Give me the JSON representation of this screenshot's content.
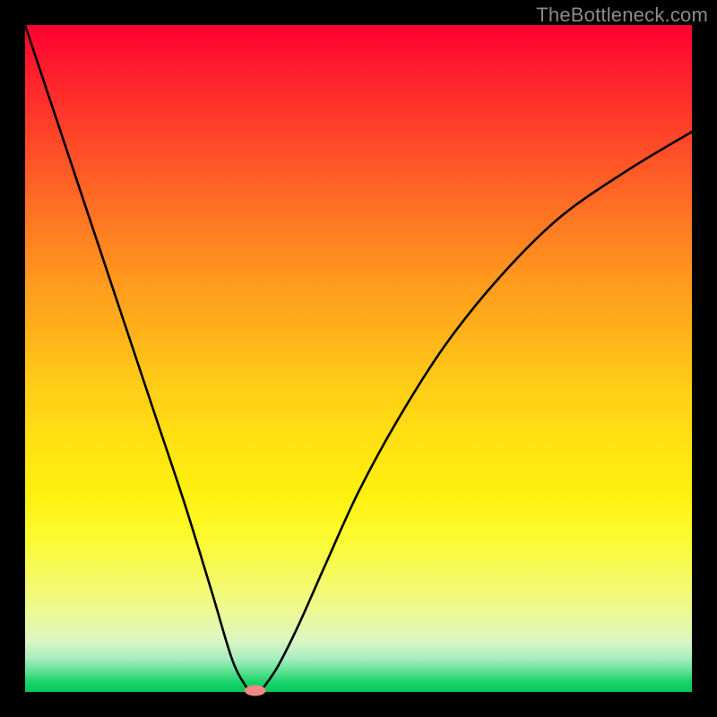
{
  "watermark": "TheBottleneck.com",
  "chart_data": {
    "type": "line",
    "title": "",
    "xlabel": "",
    "ylabel": "",
    "xlim": [
      0,
      100
    ],
    "ylim": [
      0,
      100
    ],
    "grid": false,
    "background_gradient": {
      "direction": "vertical",
      "stops": [
        {
          "pos": 0.0,
          "color": "#ff0030"
        },
        {
          "pos": 0.3,
          "color": "#ff7a22"
        },
        {
          "pos": 0.62,
          "color": "#ffe012"
        },
        {
          "pos": 0.88,
          "color": "#eef994"
        },
        {
          "pos": 1.0,
          "color": "#03c957"
        }
      ]
    },
    "series": [
      {
        "name": "bottleneck-curve",
        "color": "#000000",
        "x": [
          0,
          4,
          8,
          12,
          16,
          20,
          24,
          28,
          31,
          33,
          34,
          35,
          36,
          38,
          41,
          45,
          50,
          56,
          63,
          71,
          80,
          90,
          100
        ],
        "values": [
          100,
          88,
          76,
          64,
          52,
          40,
          28,
          15,
          5,
          1,
          0,
          0,
          1,
          4,
          10,
          19,
          30,
          41,
          52,
          62,
          71,
          78,
          84
        ]
      }
    ],
    "marker": {
      "x": 34.5,
      "y": 0.2,
      "color": "#f08884",
      "rx": 1.6,
      "ry": 0.8
    }
  }
}
